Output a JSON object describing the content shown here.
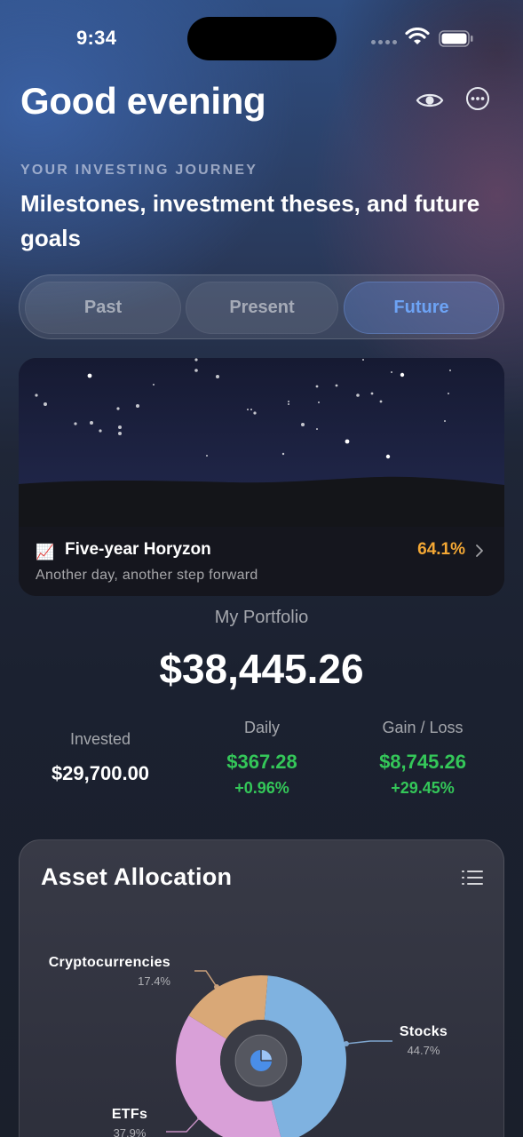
{
  "status_bar": {
    "time": "9:34"
  },
  "header": {
    "greeting": "Good evening"
  },
  "journey": {
    "eyebrow": "YOUR INVESTING JOURNEY",
    "subtitle": "Milestones, investment theses, and future goals"
  },
  "segments": {
    "items": [
      "Past",
      "Present",
      "Future"
    ],
    "selected": "Future"
  },
  "horizon_card": {
    "icon": "chart-increasing-icon",
    "emoji": "📈",
    "title": "Five-year Horyzon",
    "percent": "64.1%",
    "subtitle": "Another day, another step forward"
  },
  "portfolio": {
    "label": "My Portfolio",
    "value": "$38,445.26",
    "invested": {
      "label": "Invested",
      "value": "$29,700.00"
    },
    "daily": {
      "label": "Daily",
      "value": "$367.28",
      "change": "+0.96%"
    },
    "gain_loss": {
      "label": "Gain / Loss",
      "value": "$8,745.26",
      "change": "+29.45%"
    }
  },
  "allocation": {
    "title": "Asset Allocation",
    "center_icon": "pie-chart-icon",
    "items": [
      {
        "name": "Cryptocurrencies",
        "percent": "17.4%",
        "color": "#d9a877"
      },
      {
        "name": "Stocks",
        "percent": "44.7%",
        "color": "#7fb2e0"
      },
      {
        "name": "ETFs",
        "percent": "37.9%",
        "color": "#d9a0d8"
      }
    ]
  },
  "colors": {
    "accent": "#6da3f5",
    "positive": "#34c759",
    "highlight": "#f3a734"
  }
}
